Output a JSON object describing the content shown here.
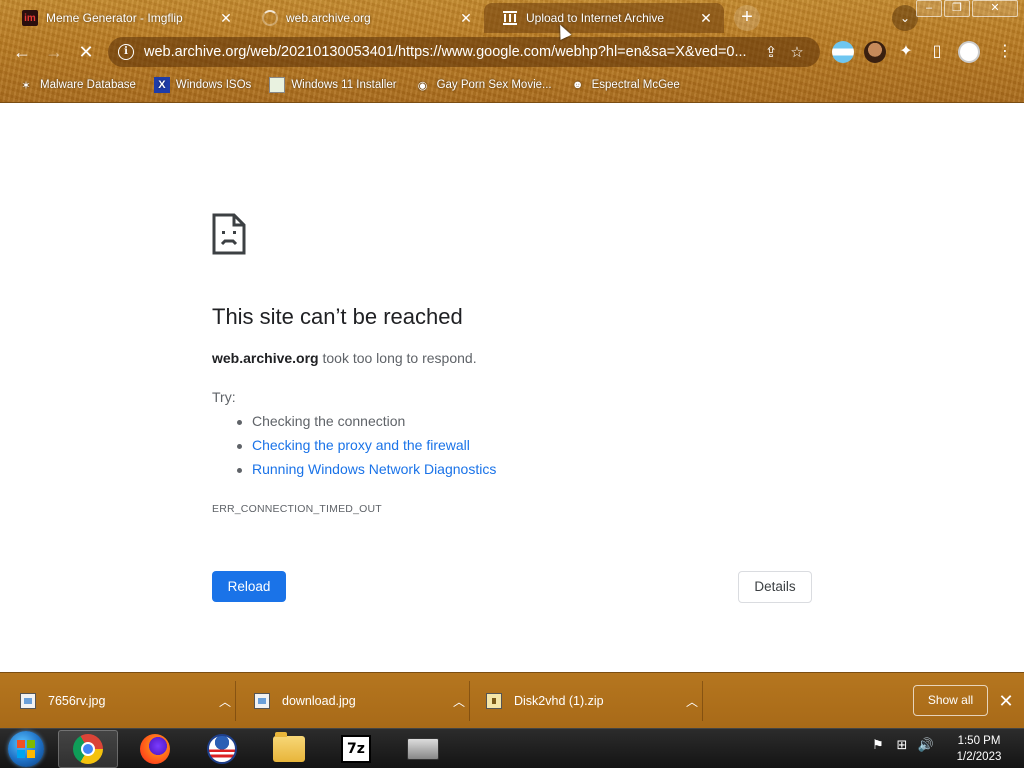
{
  "tabs": [
    {
      "title": "Meme Generator - Imgflip",
      "favicon": "imgflip-icon",
      "favicon_text": "im",
      "active": false
    },
    {
      "title": "web.archive.org",
      "favicon": "loading-spinner-icon",
      "active": false
    },
    {
      "title": "Upload to Internet Archive",
      "favicon": "archive-columns-icon",
      "active": true
    }
  ],
  "omnibox": {
    "url": "web.archive.org/web/20210130053401/https://www.google.com/webhp?hl=en&sa=X&ved=0..."
  },
  "bookmarks": [
    {
      "label": "Malware Database",
      "icon": "fly-icon"
    },
    {
      "label": "Windows ISOs",
      "icon": "x-icon",
      "icon_text": "X"
    },
    {
      "label": "Windows 11 Installer",
      "icon": "image-icon"
    },
    {
      "label": "Gay Porn Sex Movie...",
      "icon": "disc-icon"
    },
    {
      "label": "Espectral McGee",
      "icon": "face-icon"
    }
  ],
  "error": {
    "title": "This site can’t be reached",
    "host": "web.archive.org",
    "desc_suffix": " took too long to respond.",
    "try_label": "Try:",
    "suggestions": [
      {
        "text": "Checking the connection",
        "link": false
      },
      {
        "text": "Checking the proxy and the firewall",
        "link": true
      },
      {
        "text": "Running Windows Network Diagnostics",
        "link": true
      }
    ],
    "code": "ERR_CONNECTION_TIMED_OUT",
    "reload_label": "Reload",
    "details_label": "Details"
  },
  "downloads": {
    "items": [
      {
        "name": "7656rv.jpg",
        "type": "image"
      },
      {
        "name": "download.jpg",
        "type": "image"
      },
      {
        "name": "Disk2vhd (1).zip",
        "type": "zip"
      }
    ],
    "show_all_label": "Show all"
  },
  "taskbar": {
    "apps": [
      "chrome",
      "firefox",
      "obama",
      "file-explorer",
      "7zip",
      "device"
    ],
    "time": "1:50 PM",
    "date": "1/2/2023"
  },
  "colors": {
    "link": "#1a73e8",
    "reload_button": "#1a73e8",
    "theme": "#b87a22"
  }
}
